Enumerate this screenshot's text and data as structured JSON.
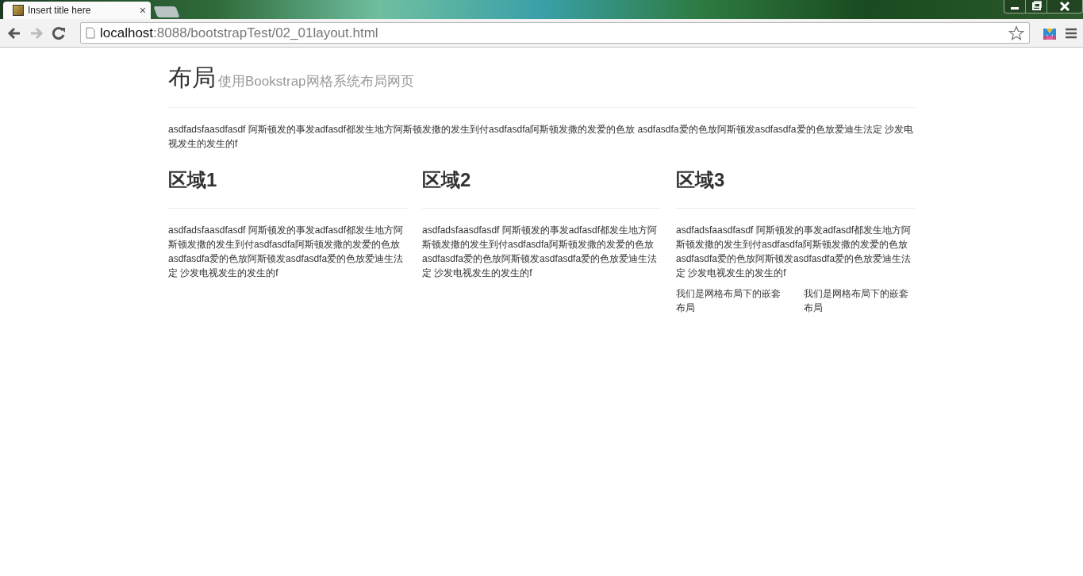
{
  "window": {
    "tabs": [
      {
        "title": "Insert title here",
        "close": "×",
        "selected": true
      }
    ]
  },
  "address_bar": {
    "host": "localhost",
    "path": ":8088/bootstrapTest/02_01layout.html"
  },
  "page": {
    "title": "布局",
    "subtitle": "使用Bookstrap网格系统布局网页",
    "intro": "asdfadsfaasdfasdf 阿斯顿发的事发adfasdf都发生地方阿斯顿发撒的发生到付asdfasdfa阿斯顿发撒的发爱的色放 asdfasdfa爱的色放阿斯顿发asdfasdfa爱的色放爱迪生法定 沙发电视发生的发生的f",
    "sections": [
      {
        "heading": "区域1",
        "text": "asdfadsfaasdfasdf 阿斯顿发的事发adfasdf都发生地方阿斯顿发撒的发生到付asdfasdfa阿斯顿发撒的发爱的色放 asdfasdfa爱的色放阿斯顿发asdfasdfa爱的色放爱迪生法定 沙发电视发生的发生的f"
      },
      {
        "heading": "区域2",
        "text": "asdfadsfaasdfasdf 阿斯顿发的事发adfasdf都发生地方阿斯顿发撒的发生到付asdfasdfa阿斯顿发撒的发爱的色放 asdfasdfa爱的色放阿斯顿发asdfasdfa爱的色放爱迪生法定 沙发电视发生的发生的f"
      },
      {
        "heading": "区域3",
        "text": "asdfadsfaasdfasdf 阿斯顿发的事发adfasdf都发生地方阿斯顿发撒的发生到付asdfasdfa阿斯顿发撒的发爱的色放 asdfasdfa爱的色放阿斯顿发asdfasdfa爱的色放爱迪生法定 沙发电视发生的发生的f",
        "nested": [
          "我们是网格布局下的嵌套布局",
          "我们是网格布局下的嵌套布局"
        ]
      }
    ]
  }
}
